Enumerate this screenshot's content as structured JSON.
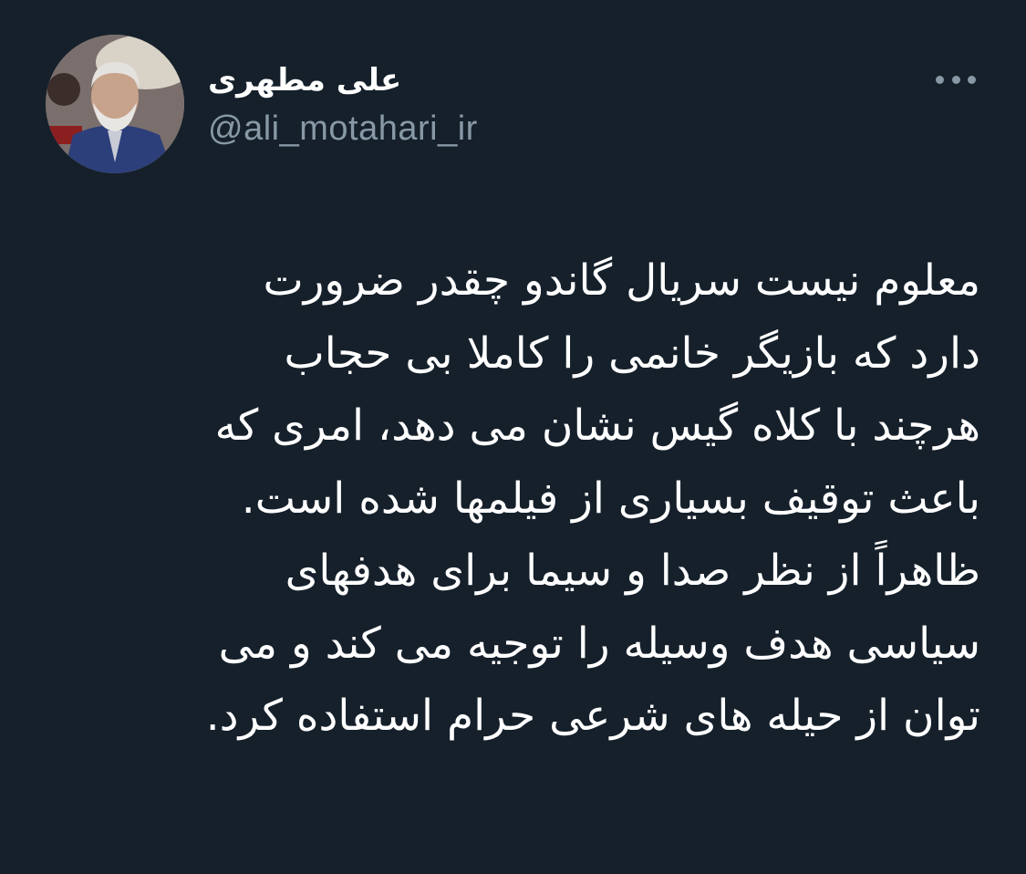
{
  "tweet": {
    "author_name": "علی مطهری",
    "author_handle": "@ali_motahari_ir",
    "more_icon": "more-horizontal-icon",
    "lines": [
      "معلوم نیست سریال گاندو چقدر ضرورت",
      "دارد که بازیگر خانمی را کاملا بی حجاب",
      "هرچند با کلاه گیس نشان می دهد، امری که",
      "باعث توقیف بسیاری از فیلمها شده است.",
      "ظاهراً از نظر صدا و سیما برای هدفهای",
      "سیاسی هدف وسیله را توجیه می کند و می",
      "توان از حیله های شرعی حرام استفاده کرد."
    ]
  },
  "colors": {
    "background": "#15202b",
    "text": "#ffffff",
    "secondary": "#8899a6"
  }
}
